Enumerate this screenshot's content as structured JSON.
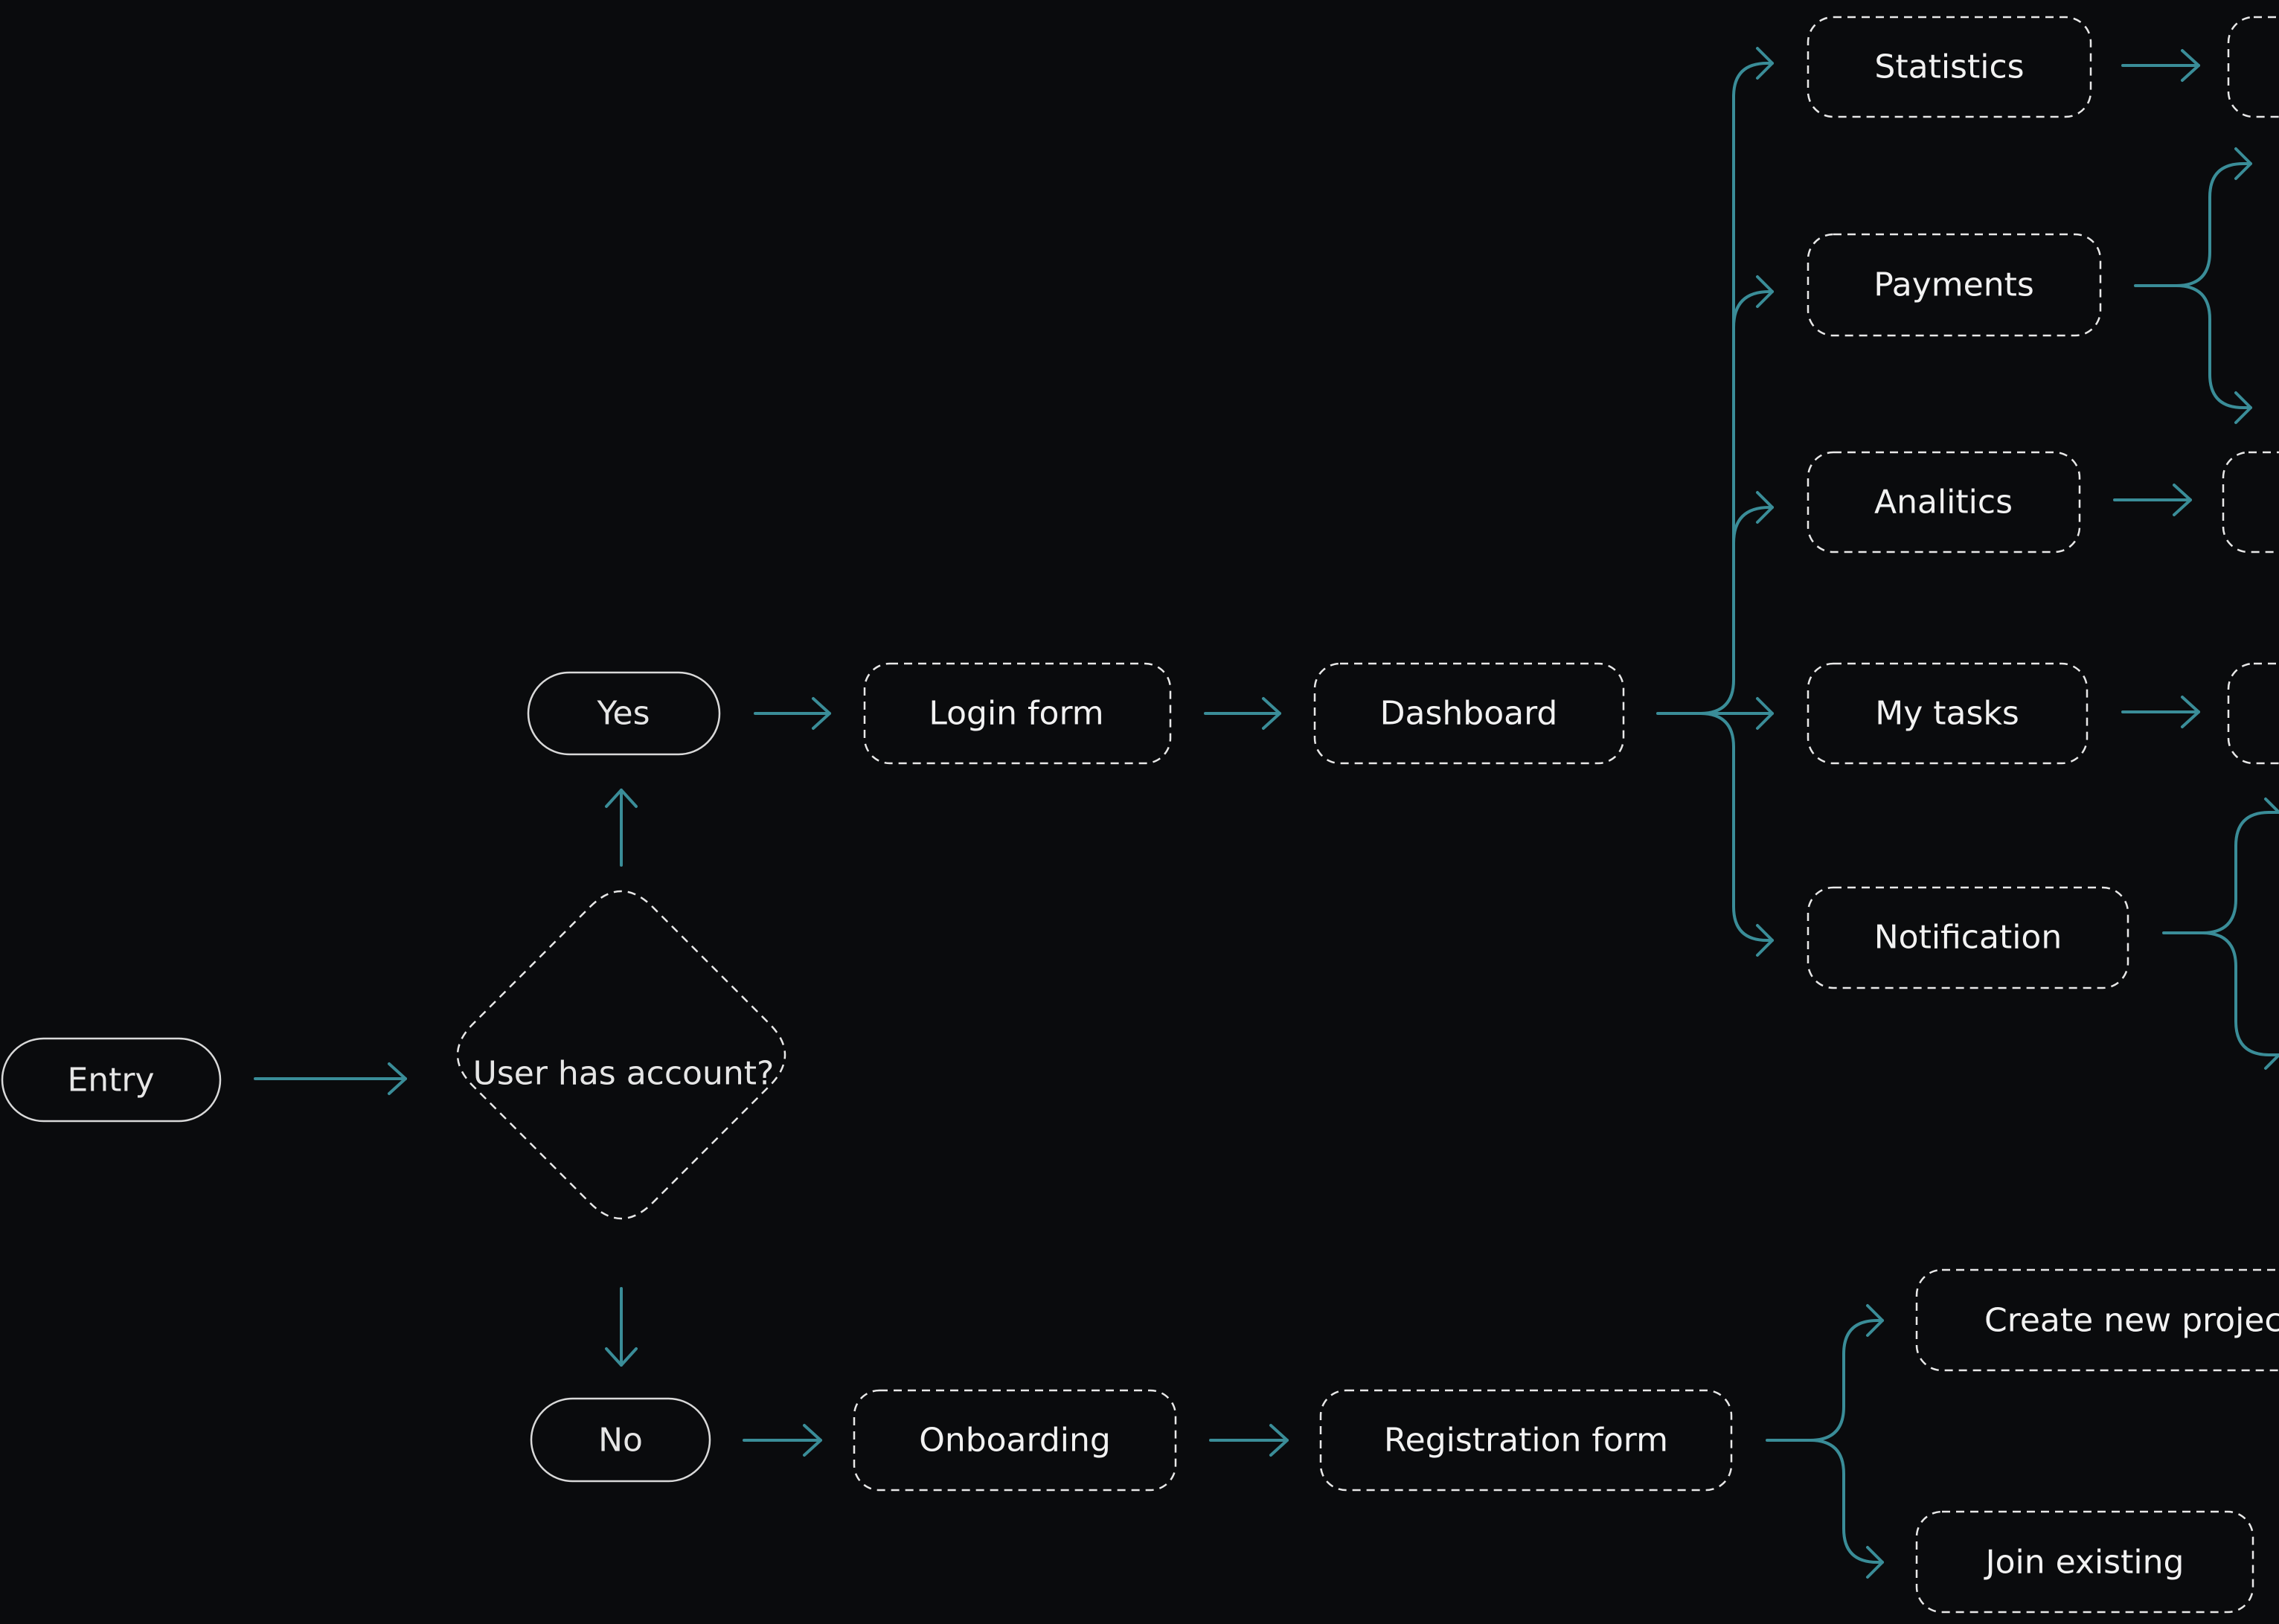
{
  "diagram": {
    "colors": {
      "background": "#0a0b0d",
      "connector": "#3a8d98",
      "node_border": "#e8e8e8",
      "text": "#f2f2f2"
    },
    "nodes": {
      "entry": "Entry",
      "decision": "User has account?",
      "yes": "Yes",
      "no": "No",
      "login_form": "Login form",
      "dashboard": "Dashboard",
      "statistics": "Statistics",
      "payments": "Payments",
      "analitics": "Analitics",
      "my_tasks": "My tasks",
      "notification": "Notification",
      "onboarding": "Onboarding",
      "registration_form": "Registration form",
      "create_new_project": "Create new project",
      "join_existing": "Join existing"
    }
  }
}
